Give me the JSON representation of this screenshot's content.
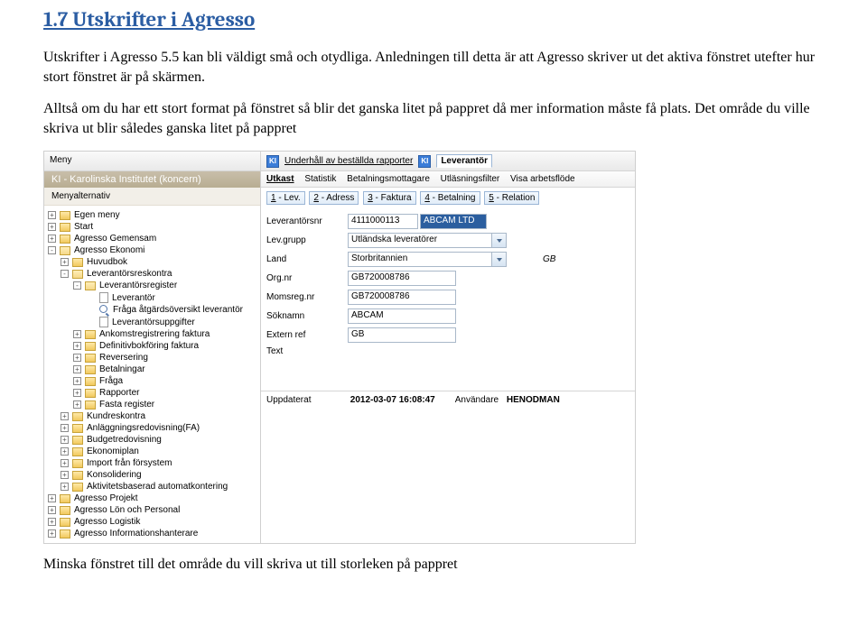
{
  "heading": "1.7 Utskrifter i Agresso",
  "para1": "Utskrifter i Agresso 5.5 kan bli väldigt små och otydliga. Anledningen till detta är att Agresso skriver ut det aktiva fönstret utefter hur stort fönstret är på skärmen.",
  "para2": "Alltså om du har ett stort format på fönstret så blir det ganska litet på pappret då mer information måste få plats. Det område du ville skriva ut blir således ganska litet på pappret",
  "caption": "Minska fönstret till det område du vill skriva ut till storleken på pappret",
  "topbar": {
    "menu": "Meny",
    "ki": "KI",
    "tab1": "Underhåll av beställda rapporter",
    "tab2": "Leverantör"
  },
  "sidebar": {
    "title": "KI - Karolinska Institutet (koncern)",
    "subtitle": "Menyalternativ",
    "tree": [
      {
        "depth": 0,
        "exp": "+",
        "icon": "folder",
        "label": "Egen meny"
      },
      {
        "depth": 0,
        "exp": "+",
        "icon": "folder",
        "label": "Start"
      },
      {
        "depth": 0,
        "exp": "+",
        "icon": "folder",
        "label": "Agresso Gemensam"
      },
      {
        "depth": 0,
        "exp": "-",
        "icon": "folder-open",
        "label": "Agresso Ekonomi"
      },
      {
        "depth": 1,
        "exp": "+",
        "icon": "folder",
        "label": "Huvudbok"
      },
      {
        "depth": 1,
        "exp": "-",
        "icon": "folder-open",
        "label": "Leverantörsreskontra"
      },
      {
        "depth": 2,
        "exp": "-",
        "icon": "folder-open",
        "label": "Leverantörsregister"
      },
      {
        "depth": 3,
        "exp": " ",
        "icon": "doc",
        "label": "Leverantör"
      },
      {
        "depth": 3,
        "exp": " ",
        "icon": "mag",
        "label": "Fråga åtgärdsöversikt leverantör"
      },
      {
        "depth": 3,
        "exp": " ",
        "icon": "doc",
        "label": "Leverantörsuppgifter"
      },
      {
        "depth": 2,
        "exp": "+",
        "icon": "folder",
        "label": "Ankomstregistrering faktura"
      },
      {
        "depth": 2,
        "exp": "+",
        "icon": "folder",
        "label": "Definitivbokföring faktura"
      },
      {
        "depth": 2,
        "exp": "+",
        "icon": "folder",
        "label": "Reversering"
      },
      {
        "depth": 2,
        "exp": "+",
        "icon": "folder",
        "label": "Betalningar"
      },
      {
        "depth": 2,
        "exp": "+",
        "icon": "folder",
        "label": "Fråga"
      },
      {
        "depth": 2,
        "exp": "+",
        "icon": "folder",
        "label": "Rapporter"
      },
      {
        "depth": 2,
        "exp": "+",
        "icon": "folder",
        "label": "Fasta register"
      },
      {
        "depth": 1,
        "exp": "+",
        "icon": "folder",
        "label": "Kundreskontra"
      },
      {
        "depth": 1,
        "exp": "+",
        "icon": "folder",
        "label": "Anläggningsredovisning(FA)"
      },
      {
        "depth": 1,
        "exp": "+",
        "icon": "folder",
        "label": "Budgetredovisning"
      },
      {
        "depth": 1,
        "exp": "+",
        "icon": "folder",
        "label": "Ekonomiplan"
      },
      {
        "depth": 1,
        "exp": "+",
        "icon": "folder",
        "label": "Import från försystem"
      },
      {
        "depth": 1,
        "exp": "+",
        "icon": "folder",
        "label": "Konsolidering"
      },
      {
        "depth": 1,
        "exp": "+",
        "icon": "folder",
        "label": "Aktivitetsbaserad automatkontering"
      },
      {
        "depth": 0,
        "exp": "+",
        "icon": "folder",
        "label": "Agresso Projekt"
      },
      {
        "depth": 0,
        "exp": "+",
        "icon": "folder",
        "label": "Agresso Lön och Personal"
      },
      {
        "depth": 0,
        "exp": "+",
        "icon": "folder",
        "label": "Agresso Logistik"
      },
      {
        "depth": 0,
        "exp": "+",
        "icon": "folder",
        "label": "Agresso Informationshanterare"
      }
    ]
  },
  "maintabs": {
    "t1": "Utkast",
    "t2": "Statistik",
    "t3": "Betalningsmottagare",
    "t4": "Utläsningsfilter",
    "t5": "Visa arbetsflöde"
  },
  "numtabs": {
    "n1a": "1",
    "n1b": " - Lev.",
    "n2a": "2",
    "n2b": " - Adress",
    "n3a": "3",
    "n3b": " - Faktura",
    "n4a": "4",
    "n4b": " - Betalning",
    "n5a": "5",
    "n5b": " - Relation"
  },
  "form": {
    "leverantorsnr_label": "Leverantörsnr",
    "leverantorsnr": "4111000113",
    "leverantorsnr_name": "ABCAM LTD",
    "levgrupp_label": "Lev.grupp",
    "levgrupp": "Utländska leveratörer",
    "land_label": "Land",
    "land": "Storbritannien",
    "land_code": "GB",
    "orgnr_label": "Org.nr",
    "orgnr": "GB720008786",
    "momsregnr_label": "Momsreg.nr",
    "momsregnr": "GB720008786",
    "soknamn_label": "Söknamn",
    "soknamn": "ABCAM",
    "externref_label": "Extern ref",
    "externref": "GB",
    "text_label": "Text"
  },
  "update": {
    "upd_label": "Uppdaterat",
    "upd_value": "2012-03-07 16:08:47",
    "user_label": "Användare",
    "user_value": "HENODMAN"
  }
}
